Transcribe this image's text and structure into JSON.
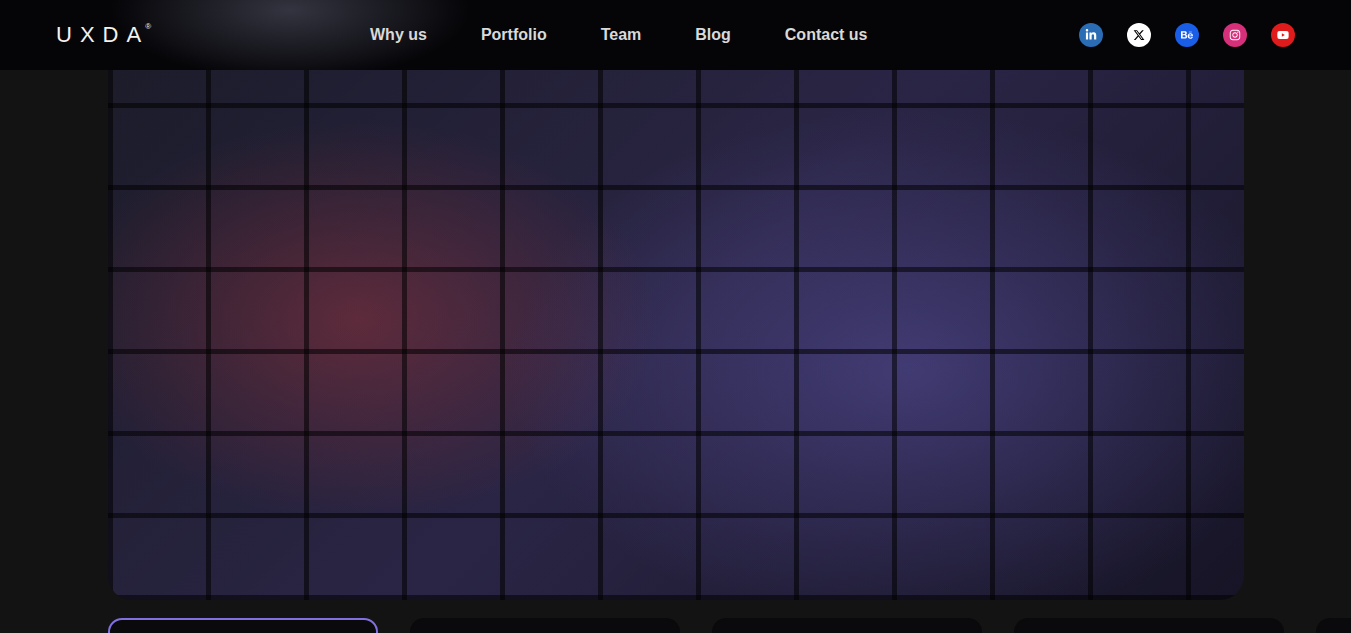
{
  "header": {
    "logo": "UXDA",
    "logo_mark": "®"
  },
  "nav": [
    {
      "label": "Why us"
    },
    {
      "label": "Portfolio"
    },
    {
      "label": "Team"
    },
    {
      "label": "Blog"
    },
    {
      "label": "Contact us"
    }
  ],
  "socials": [
    {
      "name": "linkedin",
      "color": "#2a6db5"
    },
    {
      "name": "x",
      "color": "#ffffff"
    },
    {
      "name": "behance",
      "color": "#1a5ee8"
    },
    {
      "name": "instagram",
      "color": "#d6307a"
    },
    {
      "name": "youtube",
      "color": "#e01b1b"
    }
  ],
  "cards": [
    {
      "selected": true
    },
    {
      "selected": false
    },
    {
      "selected": false
    },
    {
      "selected": false
    },
    {
      "selected": false
    }
  ]
}
